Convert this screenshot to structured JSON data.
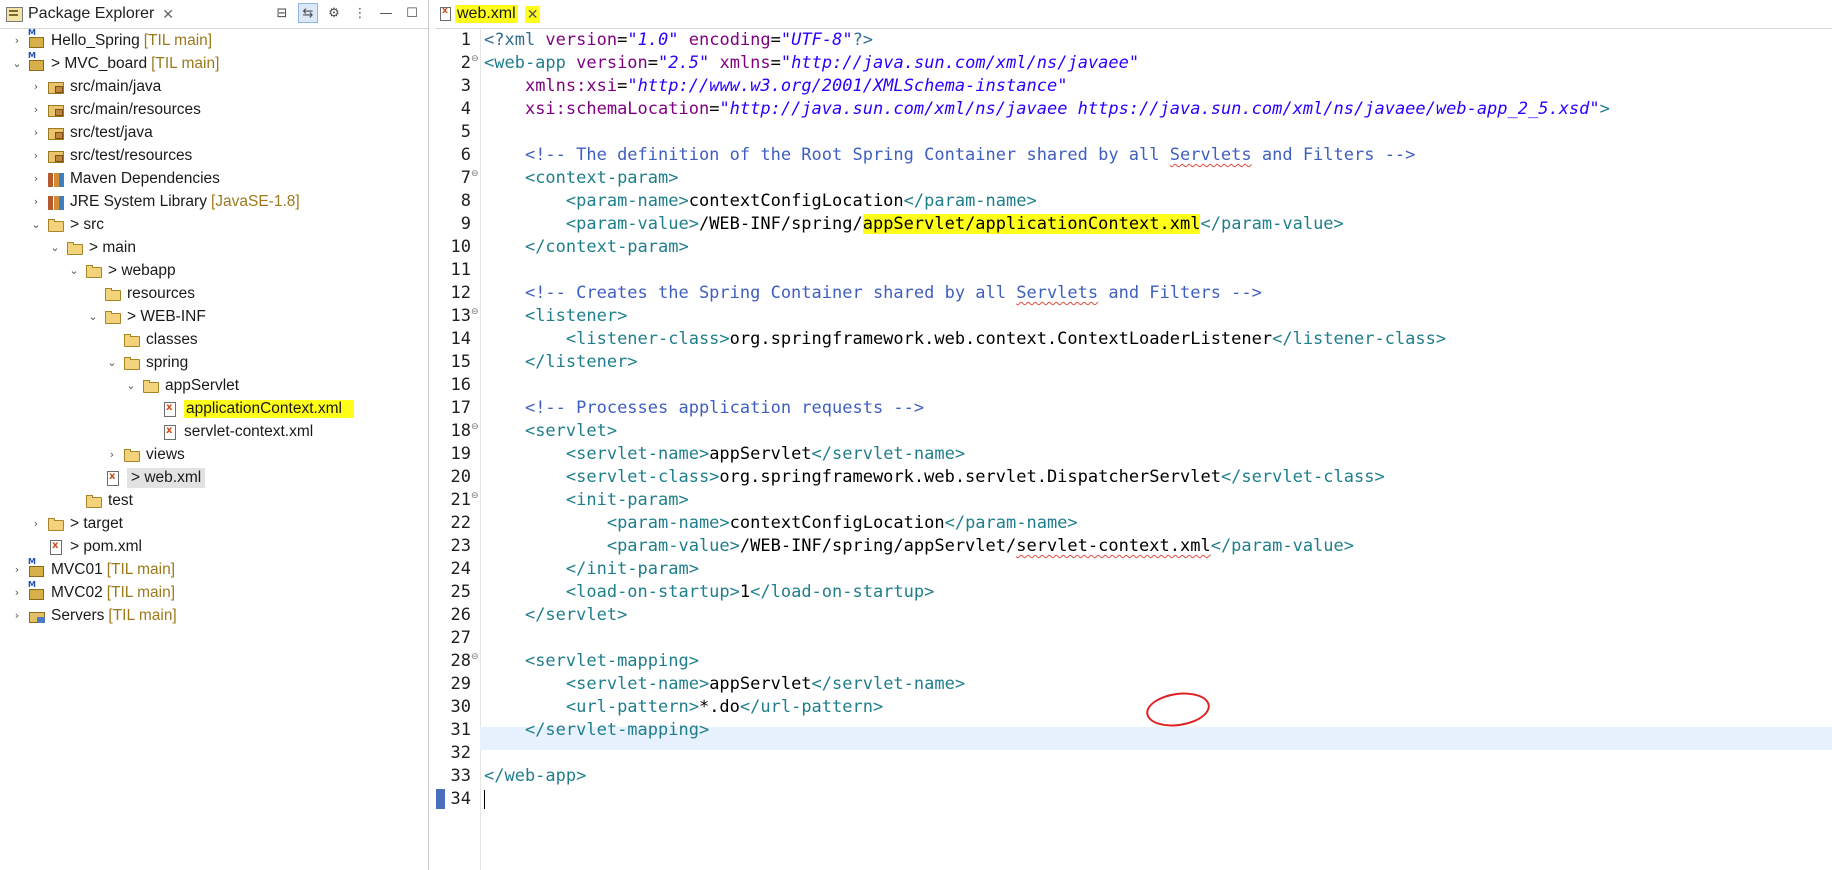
{
  "explorer": {
    "title": "Package Explorer",
    "close_glyph": "✕",
    "toolbar": {
      "collapse": "⊟",
      "link": "⇆",
      "focus": "⚙",
      "menu": "⋮",
      "minimize": "—",
      "maximize": "☐"
    },
    "tree": [
      {
        "label": "Hello_Spring",
        "decoration": "[TIL main]",
        "twisty": "›",
        "icon": "project"
      },
      {
        "label": "> MVC_board",
        "decoration": "[TIL main]",
        "twisty": "⌄",
        "icon": "project"
      },
      {
        "label": "src/main/java",
        "twisty": "›",
        "icon": "pkgfolder"
      },
      {
        "label": "src/main/resources",
        "twisty": "›",
        "icon": "pkgfolder"
      },
      {
        "label": "src/test/java",
        "twisty": "›",
        "icon": "pkgfolder"
      },
      {
        "label": "src/test/resources",
        "twisty": "›",
        "icon": "pkgfolder"
      },
      {
        "label": "Maven Dependencies",
        "twisty": "›",
        "icon": "library"
      },
      {
        "label": "JRE System Library",
        "decoration": "[JavaSE-1.8]",
        "twisty": "›",
        "icon": "library"
      },
      {
        "label": "> src",
        "twisty": "⌄",
        "icon": "folder"
      },
      {
        "label": "> main",
        "twisty": "⌄",
        "icon": "folder"
      },
      {
        "label": "> webapp",
        "twisty": "⌄",
        "icon": "folder"
      },
      {
        "label": "resources",
        "icon": "folder"
      },
      {
        "label": "> WEB-INF",
        "twisty": "⌄",
        "icon": "folder"
      },
      {
        "label": "classes",
        "icon": "folder"
      },
      {
        "label": "spring",
        "twisty": "⌄",
        "icon": "folder"
      },
      {
        "label": "appServlet",
        "twisty": "⌄",
        "icon": "folder"
      },
      {
        "label": "applicationContext.xml",
        "icon": "xmlfile",
        "highlight": true
      },
      {
        "label": "servlet-context.xml",
        "icon": "xmlfile"
      },
      {
        "label": "views",
        "twisty": "›",
        "icon": "folder"
      },
      {
        "label": "> web.xml",
        "icon": "xmlfile",
        "selected": true
      },
      {
        "label": "test",
        "icon": "folder"
      },
      {
        "label": "> target",
        "twisty": "›",
        "icon": "folder"
      },
      {
        "label": "> pom.xml",
        "icon": "xmlfile"
      },
      {
        "label": "MVC01",
        "decoration": "[TIL main]",
        "twisty": "›",
        "icon": "project"
      },
      {
        "label": "MVC02",
        "decoration": "[TIL main]",
        "twisty": "›",
        "icon": "project"
      },
      {
        "label": "Servers",
        "decoration": "[TIL main]",
        "twisty": "›",
        "icon": "server"
      }
    ]
  },
  "editor": {
    "tab_name": "web.xml",
    "close_glyph": "✕",
    "line_numbers": [
      "1",
      "2",
      "3",
      "4",
      "5",
      "6",
      "7",
      "8",
      "9",
      "10",
      "11",
      "12",
      "13",
      "14",
      "15",
      "16",
      "17",
      "18",
      "19",
      "20",
      "21",
      "22",
      "23",
      "24",
      "25",
      "26",
      "27",
      "28",
      "29",
      "30",
      "31",
      "32",
      "33",
      "34"
    ],
    "fold_marker": "⊖",
    "code": {
      "l1": {
        "a": "<?xml ",
        "b": "version",
        "c": "=",
        "d": "\"1.0\"",
        "e": " ",
        "f": "encoding",
        "g": "=",
        "h": "\"UTF-8\"",
        "i": "?>"
      },
      "l2": {
        "a": "<web-app ",
        "b": "version",
        "c": "=",
        "d": "\"2.5\"",
        "e": " ",
        "f": "xmlns",
        "g": "=",
        "h": "\"http://java.sun.com/xml/ns/javaee\""
      },
      "l3": {
        "a": "    ",
        "b": "xmlns:xsi",
        "c": "=",
        "d": "\"http://www.w3.org/2001/XMLSchema-instance\""
      },
      "l4": {
        "a": "    ",
        "b": "xsi:schemaLocation",
        "c": "=",
        "d": "\"http://java.sun.com/xml/ns/javaee https://java.sun.com/xml/ns/javaee/web-app_2_5.xsd\"",
        "e": ">"
      },
      "l6": {
        "a": "    ",
        "b": "<!-- The definition of the Root Spring Container shared by all ",
        "c": "Servlets",
        "d": " and Filters -->"
      },
      "l7": {
        "a": "    ",
        "b": "<context-param>"
      },
      "l8": {
        "a": "        ",
        "b": "<param-name>",
        "c": "contextConfigLocation",
        "d": "</param-name>"
      },
      "l9": {
        "a": "        ",
        "b": "<param-value>",
        "c": "/WEB-INF/spring/",
        "d": "appServlet/applicationContext.xml",
        "e": "</param-value>"
      },
      "l10": {
        "a": "    ",
        "b": "</context-param>"
      },
      "l12": {
        "a": "    ",
        "b": "<!-- Creates the Spring Container shared by all ",
        "c": "Servlets",
        "d": " and Filters -->"
      },
      "l13": {
        "a": "    ",
        "b": "<listener>"
      },
      "l14": {
        "a": "        ",
        "b": "<listener-class>",
        "c": "org.springframework.web.context.ContextLoaderListener",
        "d": "</listener-class>"
      },
      "l15": {
        "a": "    ",
        "b": "</listener>"
      },
      "l17": {
        "a": "    ",
        "b": "<!-- Processes application requests -->"
      },
      "l18": {
        "a": "    ",
        "b": "<servlet>"
      },
      "l19": {
        "a": "        ",
        "b": "<servlet-name>",
        "c": "appServlet",
        "d": "</servlet-name>"
      },
      "l20": {
        "a": "        ",
        "b": "<servlet-class>",
        "c": "org.springframework.web.servlet.DispatcherServlet",
        "d": "</servlet-class>"
      },
      "l21": {
        "a": "        ",
        "b": "<init-param>"
      },
      "l22": {
        "a": "            ",
        "b": "<param-name>",
        "c": "contextConfigLocation",
        "d": "</param-name>"
      },
      "l23": {
        "a": "            ",
        "b": "<param-value>",
        "c": "/WEB-INF/spring/appServlet/",
        "d": "servlet-context.xml",
        "e": "</param-value>"
      },
      "l24": {
        "a": "        ",
        "b": "</init-param>"
      },
      "l25": {
        "a": "        ",
        "b": "<load-on-startup>",
        "c": "1",
        "d": "</load-on-startup>"
      },
      "l26": {
        "a": "    ",
        "b": "</servlet>"
      },
      "l28": {
        "a": "    ",
        "b": "<servlet-mapping>"
      },
      "l29": {
        "a": "        ",
        "b": "<servlet-name>",
        "c": "appServlet",
        "d": "</servlet-name>"
      },
      "l30": {
        "a": "        ",
        "b": "<url-pattern>",
        "c": "*.do",
        "d": "</url-pattern>"
      },
      "l31": {
        "a": "    ",
        "b": "</servlet-mapping>"
      },
      "l33": {
        "a": "</web-app>"
      }
    }
  },
  "colors": {
    "highlight": "#ffff1a",
    "annotation_circle": "#e02020",
    "current_line": "#e8f2fe"
  }
}
